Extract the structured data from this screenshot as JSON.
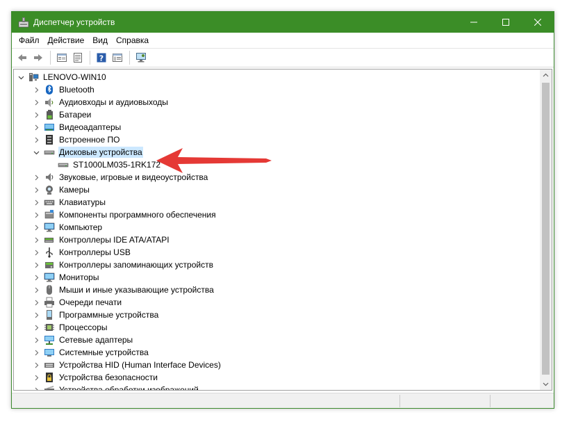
{
  "window": {
    "title": "Диспетчер устройств",
    "controls": {
      "minimize_icon": "minimize-icon",
      "maximize_icon": "maximize-icon",
      "close_icon": "close-icon"
    }
  },
  "menu": [
    "Файл",
    "Действие",
    "Вид",
    "Справка"
  ],
  "toolbar": {
    "buttons": [
      "back-icon",
      "forward-icon",
      "properties-icon",
      "update-icon",
      "help-icon",
      "show-hide-icon",
      "scan-icon"
    ]
  },
  "tree": {
    "root": {
      "label": "LENOVO-WIN10",
      "expanded": true,
      "icon": "computer-icon"
    },
    "items": [
      {
        "label": "Bluetooth",
        "icon": "bluetooth-icon",
        "expanded": false
      },
      {
        "label": "Аудиовходы и аудиовыходы",
        "icon": "audio-icon",
        "expanded": false
      },
      {
        "label": "Батареи",
        "icon": "battery-icon",
        "expanded": false
      },
      {
        "label": "Видеоадаптеры",
        "icon": "display-adapter-icon",
        "expanded": false
      },
      {
        "label": "Встроенное ПО",
        "icon": "firmware-icon",
        "expanded": false
      },
      {
        "label": "Дисковые устройства",
        "icon": "disk-drive-icon",
        "expanded": true,
        "selected": true,
        "children": [
          {
            "label": "ST1000LM035-1RK172",
            "icon": "disk-drive-icon"
          }
        ]
      },
      {
        "label": "Звуковые, игровые и видеоустройства",
        "icon": "sound-icon",
        "expanded": false
      },
      {
        "label": "Камеры",
        "icon": "camera-icon",
        "expanded": false
      },
      {
        "label": "Клавиатуры",
        "icon": "keyboard-icon",
        "expanded": false
      },
      {
        "label": "Компоненты программного обеспечения",
        "icon": "software-component-icon",
        "expanded": false
      },
      {
        "label": "Компьютер",
        "icon": "monitor-icon",
        "expanded": false
      },
      {
        "label": "Контроллеры IDE ATA/ATAPI",
        "icon": "ide-controller-icon",
        "expanded": false
      },
      {
        "label": "Контроллеры USB",
        "icon": "usb-icon",
        "expanded": false
      },
      {
        "label": "Контроллеры запоминающих устройств",
        "icon": "storage-controller-icon",
        "expanded": false
      },
      {
        "label": "Мониторы",
        "icon": "monitor-icon",
        "expanded": false
      },
      {
        "label": "Мыши и иные указывающие устройства",
        "icon": "mouse-icon",
        "expanded": false
      },
      {
        "label": "Очереди печати",
        "icon": "printer-icon",
        "expanded": false
      },
      {
        "label": "Программные устройства",
        "icon": "software-device-icon",
        "expanded": false
      },
      {
        "label": "Процессоры",
        "icon": "processor-icon",
        "expanded": false
      },
      {
        "label": "Сетевые адаптеры",
        "icon": "network-adapter-icon",
        "expanded": false
      },
      {
        "label": "Системные устройства",
        "icon": "system-device-icon",
        "expanded": false
      },
      {
        "label": "Устройства HID (Human Interface Devices)",
        "icon": "hid-icon",
        "expanded": false
      },
      {
        "label": "Устройства безопасности",
        "icon": "security-device-icon",
        "expanded": false
      },
      {
        "label": "Устройства обработки изображений",
        "icon": "imaging-device-icon",
        "expanded": false
      }
    ]
  },
  "colors": {
    "titlebar": "#3b8d27",
    "selection": "#cce8ff",
    "annotation_arrow": "#e53935"
  }
}
